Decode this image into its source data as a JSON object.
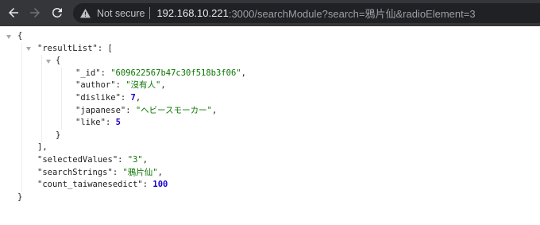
{
  "toolbar": {
    "security_label": "Not secure",
    "url_host": "192.168.10.221",
    "url_path": ":3000/searchModule?search=鴉片仙&radioElement=3",
    "icons": {
      "back": "arrow-left-icon",
      "forward": "arrow-right-icon",
      "reload": "reload-icon",
      "security": "warning-triangle-icon",
      "collapse": "triangle-down-icon"
    }
  },
  "colors": {
    "toolbar": "#35363a",
    "omnibox": "#202124",
    "string_value": "#0b7500",
    "number_value": "#1a01cc"
  },
  "json_view": {
    "colon": ":",
    "comma": ",",
    "root": {
      "open": "{",
      "close": "}"
    },
    "result_list": {
      "key": "\"resultList\"",
      "open": "[",
      "close": "]",
      "item": {
        "open": "{",
        "close": "}",
        "fields": [
          {
            "key": "\"_id\"",
            "value": "\"609622567b47c30f518b3f06\""
          },
          {
            "key": "\"author\"",
            "value": "\"沒有人\""
          },
          {
            "key": "\"dislike\"",
            "value": "7"
          },
          {
            "key": "\"japanese\"",
            "value": "\"ヘビースモーカー\""
          },
          {
            "key": "\"like\"",
            "value": "5"
          }
        ]
      }
    },
    "fields": [
      {
        "key": "\"selectedValues\"",
        "value": "\"3\""
      },
      {
        "key": "\"searchStrings\"",
        "value": "\"鴉片仙\""
      },
      {
        "key": "\"count_taiwanesedict\"",
        "value": "100"
      }
    ]
  }
}
